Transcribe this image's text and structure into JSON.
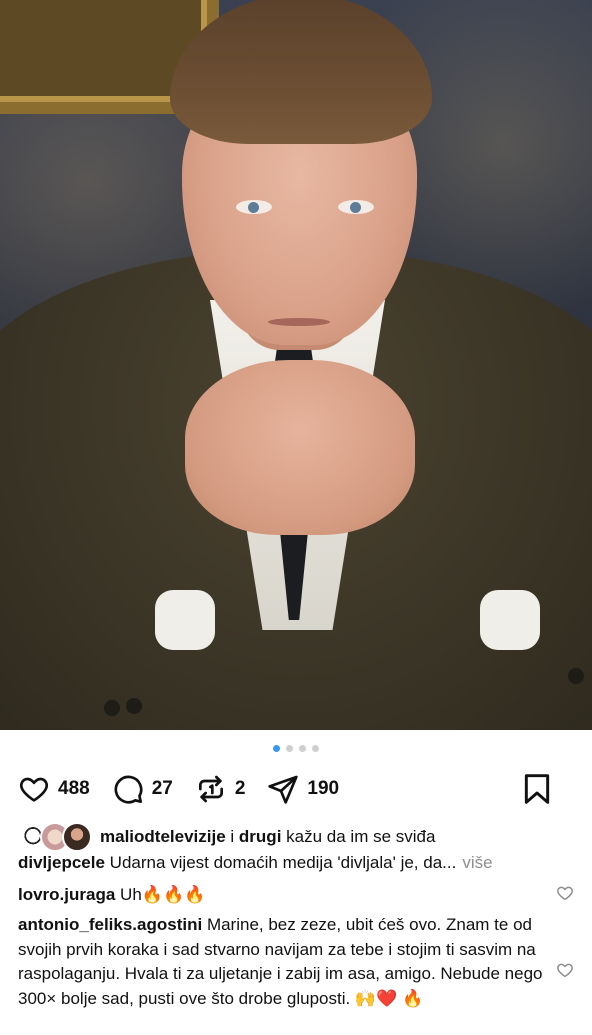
{
  "post": {
    "likes": "488",
    "comments": "27",
    "reposts": "2",
    "shares": "190"
  },
  "carousel": {
    "total": 4,
    "active": 0
  },
  "liked_by": {
    "user": "maliodtelevizije",
    "connector": "i",
    "others": "drugi",
    "suffix": "kažu da im se sviđa"
  },
  "caption": {
    "username": "divljepcele",
    "text": "Udarna vijest domaćih medija 'divljala' je, da...",
    "more": "više"
  },
  "comments": [
    {
      "username": "lovro.juraga",
      "text": "Uh🔥🔥🔥"
    },
    {
      "username": "antonio_feliks.agostini",
      "text": "Marine, bez zeze, ubit ćeš ovo. Znam te od svojih prvih koraka i sad stvarno navijam za tebe i stojim ti sasvim na raspolaganju. Hvala ti za uljetanje i zabij im asa, amigo. Nebude nego 300× bolje sad, pusti ove što drobe gluposti. 🙌❤️ 🔥"
    }
  ],
  "icons": {
    "like": "heart-icon",
    "comment": "comment-icon",
    "repost": "repost-icon",
    "share": "send-icon",
    "save": "bookmark-icon",
    "comment_like": "heart-icon"
  },
  "colors": {
    "active_dot": "#3897f0",
    "muted": "#8e8e8e"
  }
}
